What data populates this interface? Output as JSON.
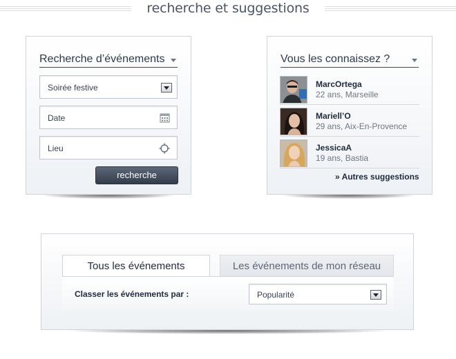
{
  "header": {
    "title": "recherche et suggestions"
  },
  "search": {
    "title": "Recherche d’événements",
    "type_value": "Soirée festive",
    "date_value": "Date",
    "location_value": "Lieu",
    "button_label": "recherche"
  },
  "suggestions": {
    "title": "Vous les connaissez ?",
    "people": [
      {
        "name": "MarcOrtega",
        "info": "22 ans, Marseille"
      },
      {
        "name": "Mariell’O",
        "info": "29 ans, Aix-En-Provence"
      },
      {
        "name": "JessicaA",
        "info": "19 ans, Bastia"
      }
    ],
    "more_label": "» Autres suggestions"
  },
  "events": {
    "tabs": [
      {
        "label": "Tous les événements",
        "active": true
      },
      {
        "label": "Les événements de mon réseau",
        "active": false
      }
    ],
    "sort_label": "Classer les événements par :",
    "sort_value": "Popularité"
  },
  "colors": {
    "button_dark": "#333c4a",
    "panel_border": "#cfd4db",
    "text_dark": "#1f2a3a"
  }
}
